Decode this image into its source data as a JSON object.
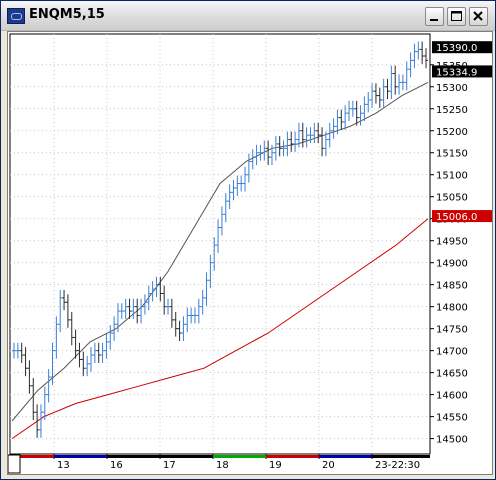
{
  "window": {
    "title": "ENQM5,15"
  },
  "chart_data": {
    "type": "candlestick",
    "symbol": "ENQM5,15",
    "y_ticks": [
      "15350",
      "15300",
      "15250",
      "15200",
      "15150",
      "15100",
      "15050",
      "15000",
      "14950",
      "14900",
      "14850",
      "14800",
      "14750",
      "14700",
      "14650",
      "14600",
      "14550",
      "14500"
    ],
    "price_labels": [
      {
        "text": "15390.0",
        "value": 15390,
        "color": "#000000"
      },
      {
        "text": "15334.9",
        "value": 15334.9,
        "color": "#000000"
      },
      {
        "text": "15006.0",
        "value": 15006,
        "color": "#cc0000"
      }
    ],
    "x_ticks": [
      "13",
      "16",
      "17",
      "18",
      "19",
      "20",
      "23-22:30"
    ],
    "day_bar_colors": [
      "#cc0000",
      "#0000aa",
      "#000000",
      "#000000",
      "#00aa00",
      "#cc0000",
      "#0000aa",
      "#000000"
    ],
    "ylim": [
      14465,
      15420
    ],
    "series": [
      {
        "name": "price",
        "values": [
          14700,
          14700,
          14690,
          14660,
          14620,
          14560,
          14520,
          14560,
          14600,
          14640,
          14700,
          14760,
          14820,
          14810,
          14770,
          14730,
          14700,
          14680,
          14660,
          14670,
          14690,
          14700,
          14690,
          14700,
          14720,
          14740,
          14760,
          14790,
          14790,
          14800,
          14790,
          14800,
          14780,
          14800,
          14810,
          14830,
          14840,
          14850,
          14830,
          14800,
          14800,
          14770,
          14750,
          14740,
          14760,
          14780,
          14780,
          14780,
          14800,
          14820,
          14860,
          14900,
          14940,
          14980,
          15010,
          15040,
          15060,
          15070,
          15080,
          15080,
          15100,
          15130,
          15140,
          15150,
          15150,
          15160,
          15140,
          15150,
          15170,
          15160,
          15160,
          15180,
          15170,
          15180,
          15200,
          15180,
          15190,
          15190,
          15200,
          15190,
          15160,
          15180,
          15200,
          15210,
          15230,
          15220,
          15240,
          15250,
          15250,
          15230,
          15240,
          15260,
          15270,
          15290,
          15280,
          15270,
          15300,
          15290,
          15330,
          15300,
          15310,
          15310,
          15340,
          15360,
          15380,
          15385,
          15370,
          15360
        ]
      },
      {
        "name": "ma_fast",
        "values": [
          14540,
          14610,
          14660,
          14720,
          14750,
          14800,
          14880,
          14980,
          15080,
          15130,
          15160,
          15170,
          15190,
          15210,
          15240,
          15280,
          15310
        ]
      },
      {
        "name": "ma_slow",
        "values": [
          14500,
          14550,
          14580,
          14600,
          14620,
          14640,
          14660,
          14700,
          14740,
          14790,
          14840,
          14890,
          14940,
          15000
        ]
      }
    ]
  }
}
